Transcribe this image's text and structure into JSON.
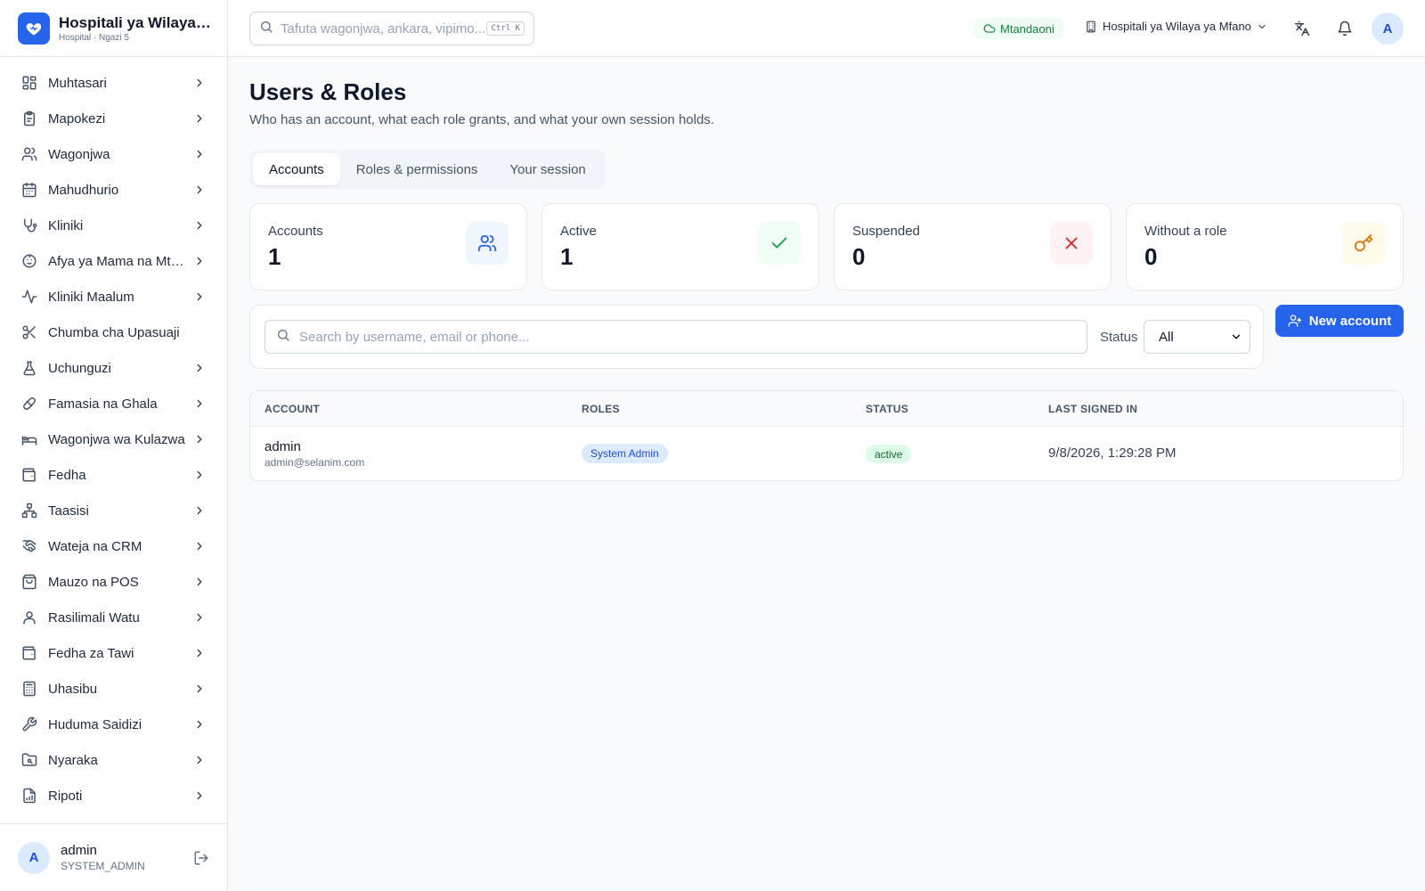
{
  "brand": {
    "name": "Hospitali ya Wilaya ya Mfano",
    "subtitle": "Hospital · Ngazi 5"
  },
  "sidebar": {
    "items": [
      {
        "label": "Muhtasari",
        "icon": "dashboard-icon",
        "chevron": true
      },
      {
        "label": "Mapokezi",
        "icon": "clipboard-icon",
        "chevron": true
      },
      {
        "label": "Wagonjwa",
        "icon": "users-icon",
        "chevron": true
      },
      {
        "label": "Mahudhurio",
        "icon": "calendar-icon",
        "chevron": true
      },
      {
        "label": "Kliniki",
        "icon": "stethoscope-icon",
        "chevron": true
      },
      {
        "label": "Afya ya Mama na Mtoto",
        "icon": "baby-icon",
        "chevron": true
      },
      {
        "label": "Kliniki Maalum",
        "icon": "activity-icon",
        "chevron": true
      },
      {
        "label": "Chumba cha Upasuaji",
        "icon": "scissors-icon",
        "chevron": false
      },
      {
        "label": "Uchunguzi",
        "icon": "flask-icon",
        "chevron": true
      },
      {
        "label": "Famasia na Ghala",
        "icon": "pill-icon",
        "chevron": true
      },
      {
        "label": "Wagonjwa wa Kulazwa",
        "icon": "bed-icon",
        "chevron": true
      },
      {
        "label": "Fedha",
        "icon": "wallet-icon",
        "chevron": true
      },
      {
        "label": "Taasisi",
        "icon": "network-icon",
        "chevron": true
      },
      {
        "label": "Wateja na CRM",
        "icon": "handshake-icon",
        "chevron": true
      },
      {
        "label": "Mauzo na POS",
        "icon": "shopping-bag-icon",
        "chevron": true
      },
      {
        "label": "Rasilimali Watu",
        "icon": "user-icon",
        "chevron": true
      },
      {
        "label": "Fedha za Tawi",
        "icon": "wallet-icon",
        "chevron": true
      },
      {
        "label": "Uhasibu",
        "icon": "calculator-icon",
        "chevron": true
      },
      {
        "label": "Huduma Saidizi",
        "icon": "wrench-icon",
        "chevron": true
      },
      {
        "label": "Nyaraka",
        "icon": "folder-icon",
        "chevron": true
      },
      {
        "label": "Ripoti",
        "icon": "report-icon",
        "chevron": true
      }
    ],
    "footer": {
      "avatar": "A",
      "username": "admin",
      "role": "SYSTEM_ADMIN"
    }
  },
  "topbar": {
    "search_placeholder": "Tafuta wagonjwa, ankara, vipimo...",
    "shortcut": "Ctrl K",
    "online_label": "Mtandaoni",
    "facility_label": "Hospitali ya Wilaya ya Mfano",
    "avatar": "A"
  },
  "page": {
    "title": "Users & Roles",
    "subtitle": "Who has an account, what each role grants, and what your own session holds."
  },
  "tabs": [
    {
      "label": "Accounts",
      "active": true
    },
    {
      "label": "Roles & permissions",
      "active": false
    },
    {
      "label": "Your session",
      "active": false
    }
  ],
  "stats": [
    {
      "label": "Accounts",
      "value": "1",
      "icon": "users-icon",
      "bg": "#eff6ff",
      "color": "#2563eb"
    },
    {
      "label": "Active",
      "value": "1",
      "icon": "check-icon",
      "bg": "#f0fdf4",
      "color": "#16a34a"
    },
    {
      "label": "Suspended",
      "value": "0",
      "icon": "x-icon",
      "bg": "#fef2f2",
      "color": "#dc2626"
    },
    {
      "label": "Without a role",
      "value": "0",
      "icon": "key-icon",
      "bg": "#fffbeb",
      "color": "#d97706"
    }
  ],
  "filters": {
    "search_placeholder": "Search by username, email or phone...",
    "status_label": "Status",
    "status_value": "All"
  },
  "new_account_label": "New account",
  "table": {
    "headers": [
      "ACCOUNT",
      "ROLES",
      "STATUS",
      "LAST SIGNED IN"
    ],
    "rows": [
      {
        "username": "admin",
        "email": "admin@selanim.com",
        "role": "System Admin",
        "status": "active",
        "last_signed_in": "9/8/2026, 1:29:28 PM"
      }
    ]
  },
  "colors": {
    "accent": "#2563eb",
    "online": "#15803d",
    "active_badge": "#dcfce7"
  }
}
